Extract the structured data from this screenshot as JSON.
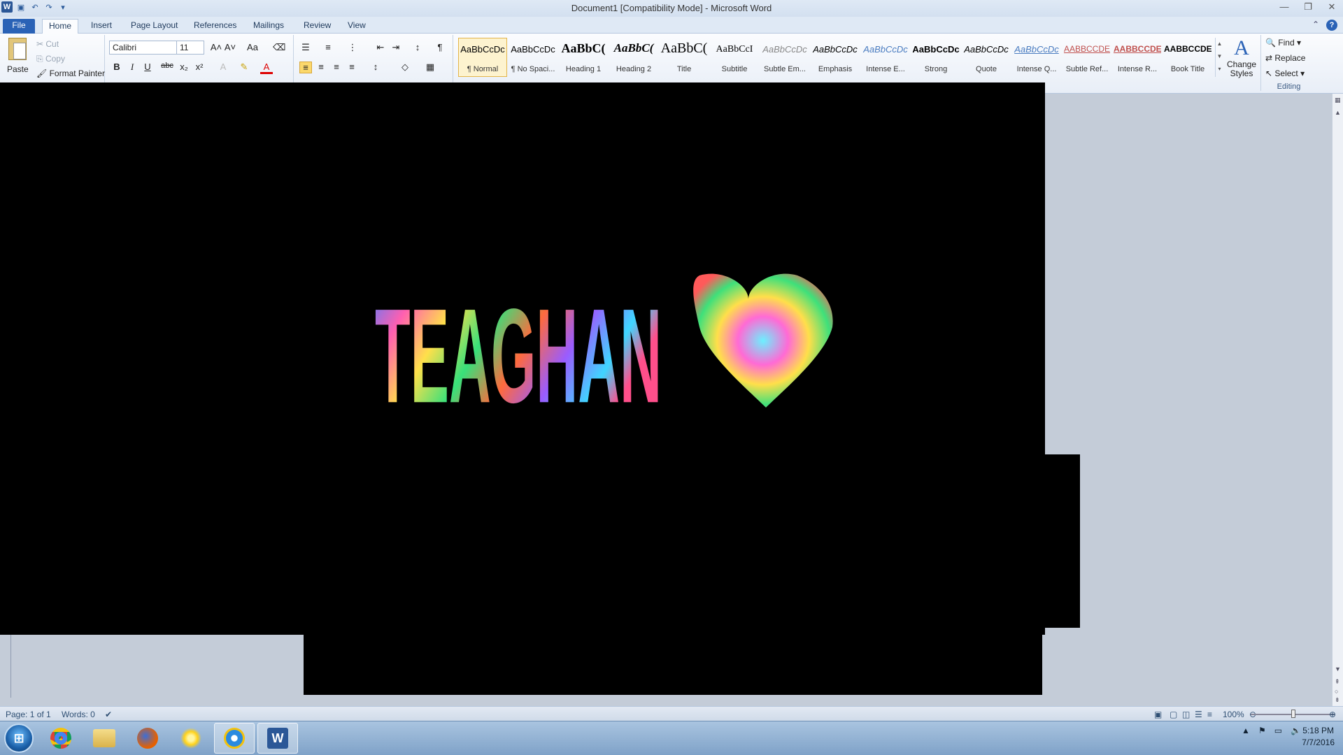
{
  "window": {
    "title": "Document1 [Compatibility Mode] - Microsoft Word"
  },
  "tabs": [
    {
      "label": "File"
    },
    {
      "label": "Home"
    },
    {
      "label": "Insert"
    },
    {
      "label": "Page Layout"
    },
    {
      "label": "References"
    },
    {
      "label": "Mailings"
    },
    {
      "label": "Review"
    },
    {
      "label": "View"
    }
  ],
  "clipboard": {
    "paste": "Paste",
    "cut": "Cut",
    "copy": "Copy",
    "format_painter": "Format Painter"
  },
  "font": {
    "name": "Calibri",
    "size": "11"
  },
  "styles": [
    {
      "sample": "AaBbCcDc",
      "name": "¶ Normal"
    },
    {
      "sample": "AaBbCcDc",
      "name": "¶ No Spaci..."
    },
    {
      "sample": "AaBbC(",
      "name": "Heading 1"
    },
    {
      "sample": "AaBbC(",
      "name": "Heading 2"
    },
    {
      "sample": "AaBbC(",
      "name": "Title"
    },
    {
      "sample": "AaBbCcI",
      "name": "Subtitle"
    },
    {
      "sample": "AaBbCcDc",
      "name": "Subtle Em..."
    },
    {
      "sample": "AaBbCcDc",
      "name": "Emphasis"
    },
    {
      "sample": "AaBbCcDc",
      "name": "Intense E..."
    },
    {
      "sample": "AaBbCcDc",
      "name": "Strong"
    },
    {
      "sample": "AaBbCcDc",
      "name": "Quote"
    },
    {
      "sample": "AaBbCcDc",
      "name": "Intense Q..."
    },
    {
      "sample": "AABBCCDE",
      "name": "Subtle Ref..."
    },
    {
      "sample": "AABBCCDE",
      "name": "Intense R..."
    },
    {
      "sample": "AABBCCDE",
      "name": "Book Title"
    }
  ],
  "change_styles": {
    "line1": "Change",
    "line2": "Styles"
  },
  "editing": {
    "find": "Find",
    "replace": "Replace",
    "select": "Select",
    "group_label": "Editing"
  },
  "document": {
    "wordart_text": "TEAGHAN"
  },
  "status": {
    "page": "Page: 1 of 1",
    "words": "Words: 0",
    "zoom": "100%"
  },
  "clock": {
    "time": "5:18 PM",
    "date": "7/7/2016"
  },
  "colors": {
    "file_tab": "#2a62b6",
    "highlight_selected": "#fbd86b",
    "document_bg": "#000000",
    "workspace_bg": "#c4ccd8"
  },
  "icons": [
    "word-icon",
    "save-icon",
    "undo-icon",
    "redo-icon",
    "customize-icon",
    "minimize-icon",
    "restore-icon",
    "close-icon",
    "help-icon",
    "heart-icon",
    "chrome-icon",
    "folder-icon",
    "firefox-icon",
    "sun-icon",
    "ie-icon",
    "word-taskbar-icon",
    "flag-icon",
    "network-icon",
    "volume-icon"
  ]
}
